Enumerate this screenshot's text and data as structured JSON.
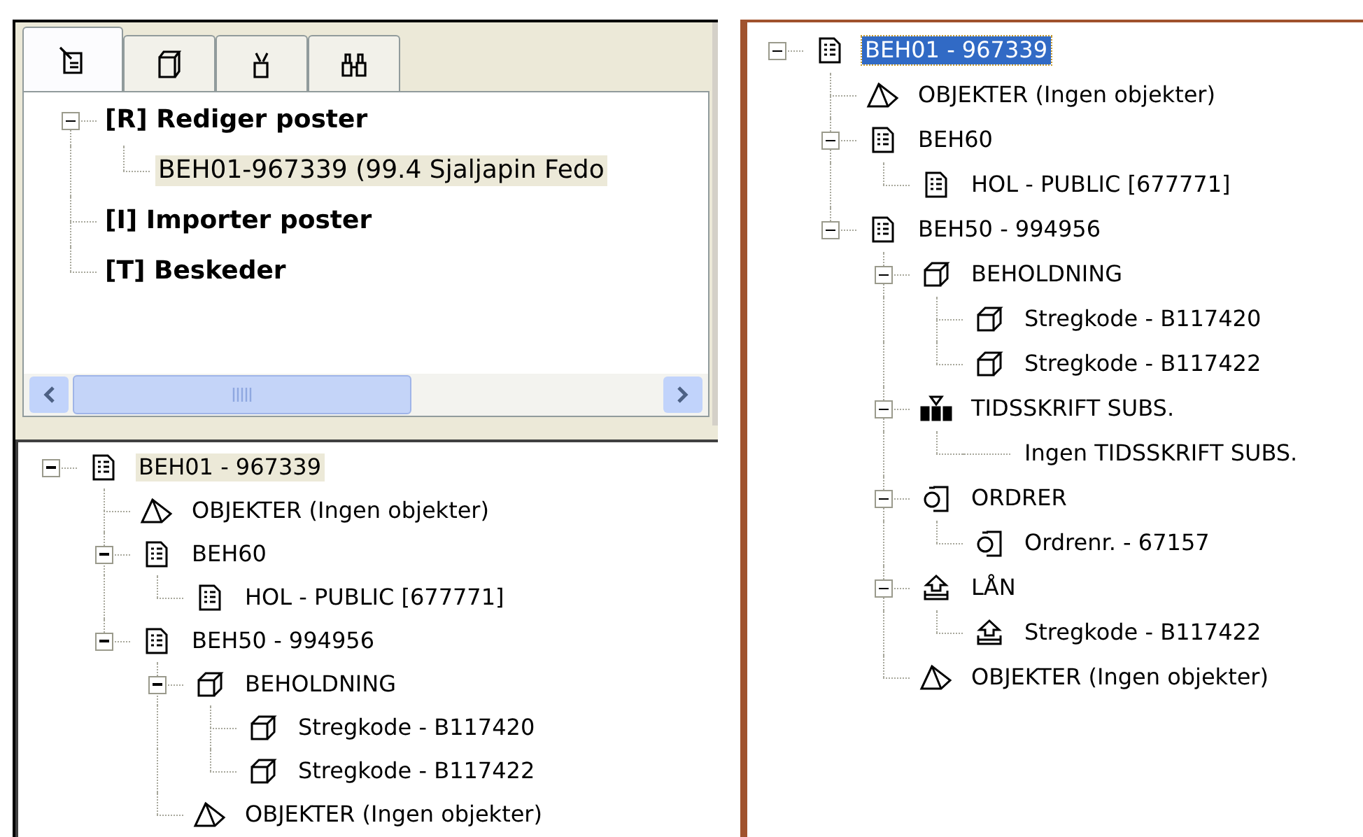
{
  "upper_left_panel": {
    "tabs": [
      {
        "selected": true
      },
      {
        "selected": false
      },
      {
        "selected": false
      },
      {
        "selected": false
      }
    ],
    "tree": {
      "focused": false,
      "nodes": [
        {
          "label": "[R] Rediger poster",
          "selected": false,
          "expanded": true,
          "children": [
            {
              "label": "BEH01-967339 (99.4 Sjaljapin Fedo",
              "selected": true
            }
          ]
        },
        {
          "label": "[I] Importer poster",
          "selected": false
        },
        {
          "label": "[T] Beskeder",
          "selected": false
        }
      ]
    }
  },
  "lower_left_panel": {
    "tree": {
      "focused": false,
      "nodes": [
        {
          "label": "BEH01 - 967339",
          "kind": "record",
          "selected": true,
          "expanded": true,
          "children": [
            {
              "label": "OBJEKTER (Ingen objekter)",
              "kind": "object",
              "selected": false
            },
            {
              "label": "BEH60",
              "kind": "record",
              "selected": false,
              "expanded": true,
              "children": [
                {
                  "label": "HOL - PUBLIC [677771]",
                  "kind": "record",
                  "selected": false
                }
              ]
            },
            {
              "label": "BEH50 - 994956",
              "kind": "record",
              "selected": false,
              "expanded": true,
              "children": [
                {
                  "label": "BEHOLDNING",
                  "kind": "holding",
                  "selected": false,
                  "expanded": true,
                  "children": [
                    {
                      "label": "Stregkode - B117420",
                      "kind": "holding",
                      "selected": false
                    },
                    {
                      "label": "Stregkode - B117422",
                      "kind": "holding",
                      "selected": false
                    }
                  ]
                },
                {
                  "label": "OBJEKTER (Ingen objekter)",
                  "kind": "object",
                  "selected": false
                }
              ]
            }
          ]
        }
      ]
    }
  },
  "right_panel": {
    "tree": {
      "focused": true,
      "nodes": [
        {
          "label": "BEH01 - 967339",
          "kind": "record",
          "selected": true,
          "expanded": true,
          "children": [
            {
              "label": "OBJEKTER (Ingen objekter)",
              "kind": "object",
              "selected": false
            },
            {
              "label": "BEH60",
              "kind": "record",
              "selected": false,
              "expanded": true,
              "children": [
                {
                  "label": "HOL - PUBLIC [677771]",
                  "kind": "record",
                  "selected": false
                }
              ]
            },
            {
              "label": "BEH50 - 994956",
              "kind": "record",
              "selected": false,
              "expanded": true,
              "children": [
                {
                  "label": "BEHOLDNING",
                  "kind": "holding",
                  "selected": false,
                  "expanded": true,
                  "children": [
                    {
                      "label": "Stregkode - B117420",
                      "kind": "holding",
                      "selected": false
                    },
                    {
                      "label": "Stregkode - B117422",
                      "kind": "holding",
                      "selected": false
                    }
                  ]
                },
                {
                  "label": "TIDSSKRIFT SUBS.",
                  "kind": "subscription",
                  "selected": false,
                  "expanded": true,
                  "children": [
                    {
                      "label": "Ingen TIDSSKRIFT SUBS.",
                      "kind": "none",
                      "selected": false
                    }
                  ]
                },
                {
                  "label": "ORDRER",
                  "kind": "order",
                  "selected": false,
                  "expanded": true,
                  "children": [
                    {
                      "label": "Ordrenr. - 67157",
                      "kind": "order",
                      "selected": false
                    }
                  ]
                },
                {
                  "label": "LÅN",
                  "kind": "loan",
                  "selected": false,
                  "expanded": true,
                  "children": [
                    {
                      "label": "Stregkode - B117422",
                      "kind": "loan",
                      "selected": false
                    }
                  ]
                },
                {
                  "label": "OBJEKTER (Ingen objekter)",
                  "kind": "object",
                  "selected": false
                }
              ]
            }
          ]
        }
      ]
    }
  }
}
